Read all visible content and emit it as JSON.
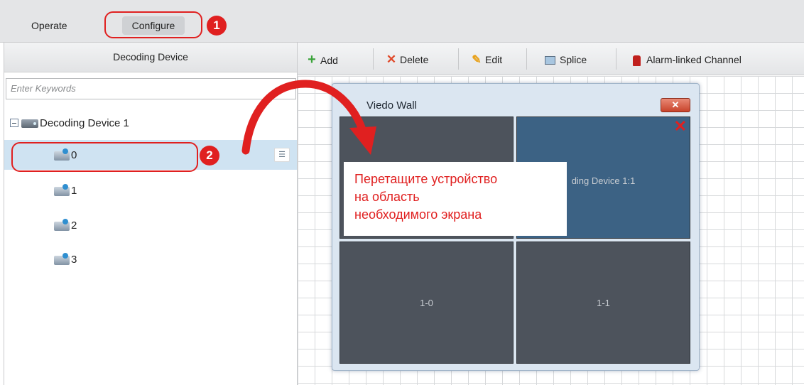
{
  "tabs": {
    "operate": "Operate",
    "configure": "Configure"
  },
  "badges": {
    "one": "1",
    "two": "2"
  },
  "left_panel": {
    "title": "Decoding Device",
    "search_placeholder": "Enter Keywords",
    "tree": {
      "root_label": "Decoding Device 1",
      "items": [
        "0",
        "1",
        "2",
        "3"
      ]
    }
  },
  "toolbar": {
    "add": "Add",
    "delete": "Delete",
    "edit": "Edit",
    "splice": "Splice",
    "alarm_linked_channel": "Alarm-linked Channel"
  },
  "dialog": {
    "title": "Viedo Wall",
    "close_symbol": "✕",
    "screens": {
      "top_right_label": "ding Device 1:1",
      "bottom_left_label": "1-0",
      "bottom_right_label": "1-1"
    }
  },
  "callout": {
    "line1": "Перетащите устройство",
    "line2": "на область",
    "line3": "необходимого экрана"
  },
  "colors": {
    "annotation_red": "#e02020",
    "selected_row": "#cfe3f2",
    "screen_dark": "#4d535c",
    "screen_active": "#3c6284"
  }
}
